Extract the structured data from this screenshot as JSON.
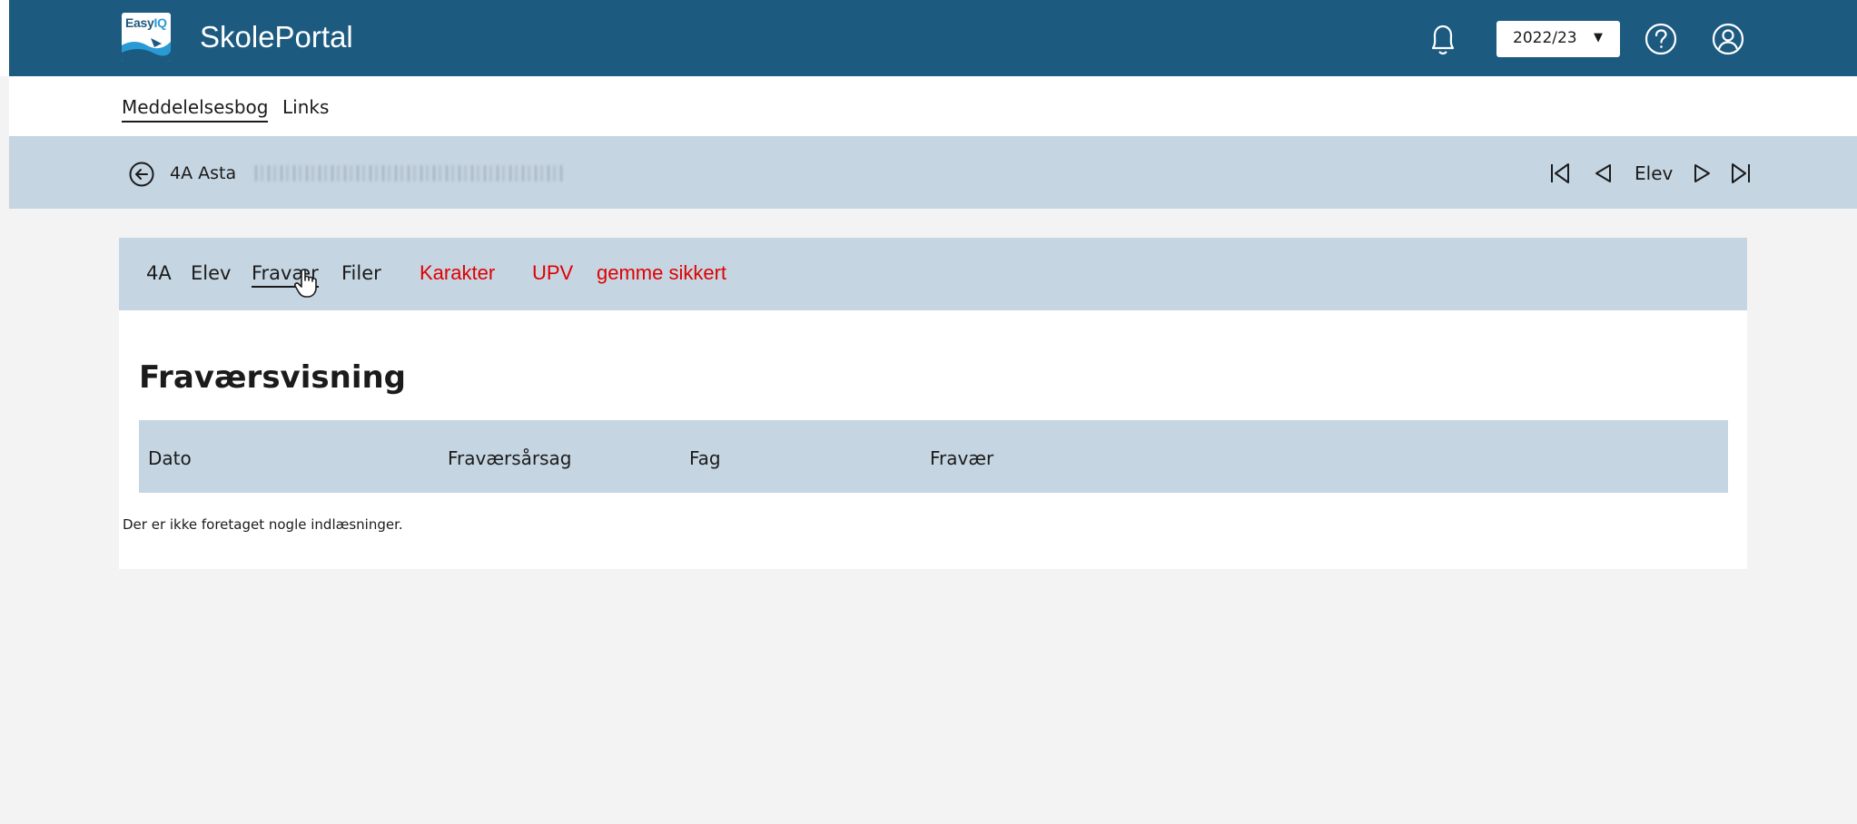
{
  "header": {
    "logo_text_a": "Easy",
    "logo_text_b": "IQ",
    "app_name": "SkolePortal",
    "year_value": "2022/23",
    "icons": [
      "bell-icon",
      "help-icon",
      "user-icon"
    ],
    "colors": {
      "topbar": "#1c5a80",
      "accent_bar": "#c5d5e2",
      "highlight_text": "#e00000"
    }
  },
  "subnav": {
    "items": [
      {
        "label": "Meddelelsesbog",
        "active": true
      },
      {
        "label": "Links",
        "active": false
      }
    ]
  },
  "student_bar": {
    "name": "4A Asta",
    "pager_label": "Elev"
  },
  "tabs": {
    "items": [
      {
        "label": "4A"
      },
      {
        "label": "Elev"
      },
      {
        "label": "Fravær"
      },
      {
        "label": "Filer"
      }
    ],
    "extra": [
      {
        "label": "Karakter"
      },
      {
        "label": "UPV"
      },
      {
        "label": "gemme sikkert"
      }
    ]
  },
  "main": {
    "title": "Fraværsvisning",
    "columns": [
      "Dato",
      "Fraværsårsag",
      "Fag",
      "Fravær"
    ],
    "empty_message": "Der er ikke foretaget nogle indlæsninger."
  }
}
